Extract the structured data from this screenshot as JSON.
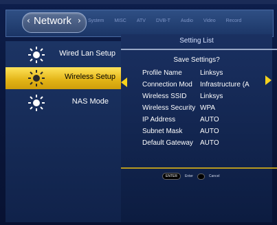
{
  "topbar": {
    "active_tab": "Network",
    "items": [
      "System",
      "MISC",
      "ATV",
      "DVB-T",
      "Audio",
      "Video",
      "Record"
    ]
  },
  "sidebar": {
    "items": [
      {
        "label": "Wired Lan Setup",
        "icon": "sun-icon"
      },
      {
        "label": "Wireless Setup",
        "icon": "sun-icon"
      },
      {
        "label": "NAS Mode",
        "icon": "sun-icon"
      }
    ],
    "selected_index": 1
  },
  "panel": {
    "title": "Setting List",
    "prompt": "Save Settings?",
    "rows": [
      {
        "key": "Profile Name",
        "value": "Linksys"
      },
      {
        "key": "Connection Mod",
        "value": "Infrastructure (A"
      },
      {
        "key": "Wireless SSID",
        "value": "Linksys"
      },
      {
        "key": "Wireless Security",
        "value": "WPA"
      },
      {
        "key": "IP Address",
        "value": "AUTO"
      },
      {
        "key": "Subnet Mask",
        "value": "AUTO"
      },
      {
        "key": "Default Gateway",
        "value": "AUTO"
      }
    ]
  },
  "buttons": {
    "enter_pill": "ENTER",
    "enter_label": "Enter",
    "cancel_label": "Cancel"
  },
  "colors": {
    "accent": "#f5d21d",
    "background": "#0a1030"
  }
}
